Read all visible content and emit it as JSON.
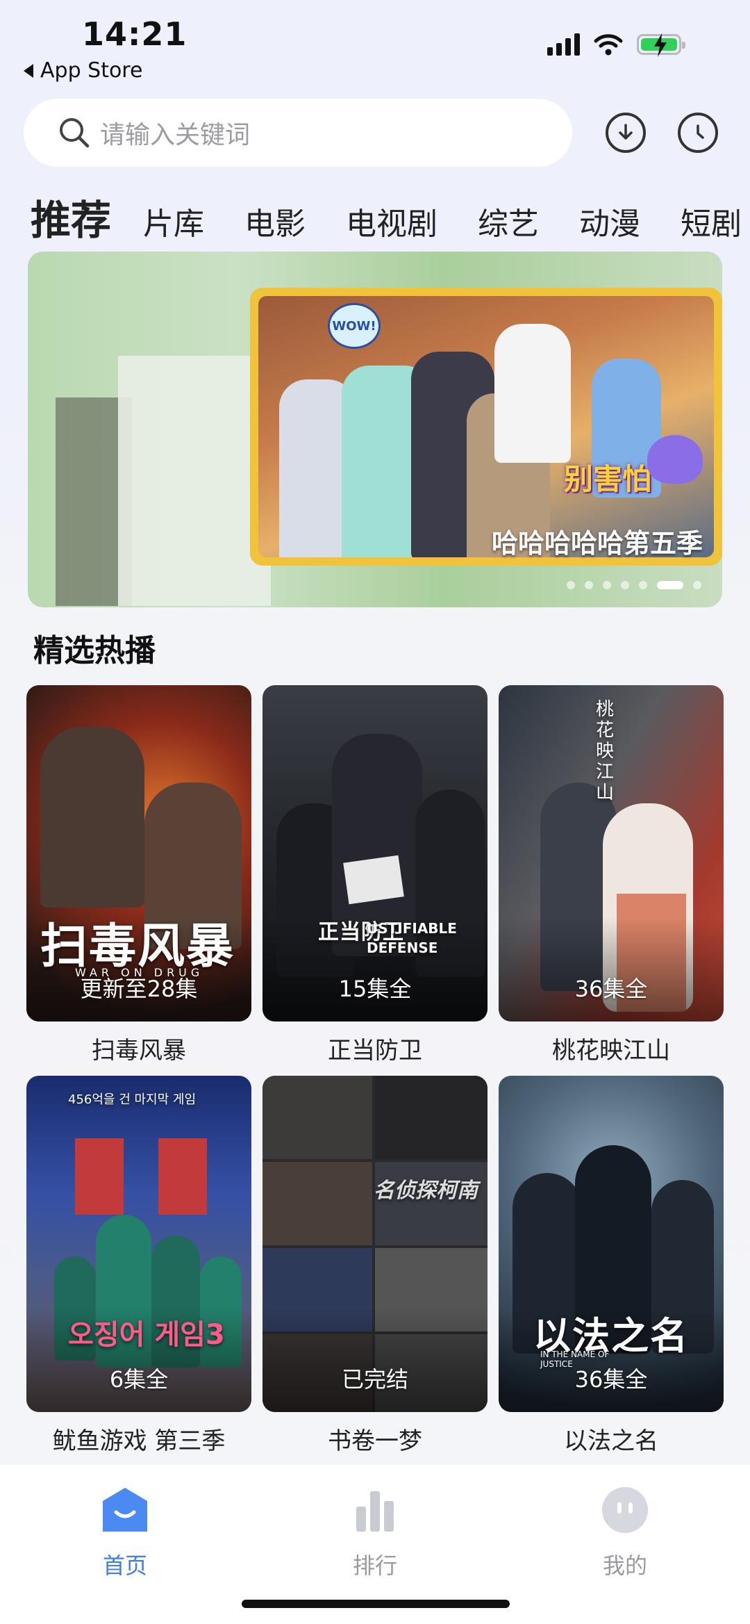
{
  "status_bar": {
    "time": "14:21",
    "back_label": "App Store"
  },
  "search": {
    "placeholder": "请输入关键词"
  },
  "tabs": [
    {
      "label": "推荐",
      "active": true
    },
    {
      "label": "片库"
    },
    {
      "label": "电影"
    },
    {
      "label": "电视剧"
    },
    {
      "label": "综艺"
    },
    {
      "label": "动漫"
    },
    {
      "label": "短剧"
    }
  ],
  "banner": {
    "caption": "哈哈哈哈哈第五季",
    "sticker_text": "别害怕",
    "wow_text": "WOW!",
    "slide_count": 7,
    "active_slide": 6
  },
  "section": {
    "title": "精选热播"
  },
  "cards": [
    {
      "title": "扫毒风暴",
      "badge": "更新至28集",
      "poster_text": "扫毒风暴",
      "poster_sub": "WAR ON DRUG"
    },
    {
      "title": "正当防卫",
      "badge": "15集全",
      "poster_text": "正当防卫",
      "poster_sub": "USTIFIABLE DEFENSE"
    },
    {
      "title": "桃花映江山",
      "badge": "36集全",
      "poster_text": "桃花映江山"
    },
    {
      "title": "鱿鱼游戏 第三季",
      "badge": "6集全",
      "poster_text": "오징어 게임3",
      "poster_top": "456억을 건 마지막 게임"
    },
    {
      "title": "书卷一梦",
      "badge": "已完结",
      "poster_text": "名侦探柯南"
    },
    {
      "title": "以法之名",
      "badge": "36集全",
      "poster_text": "以法之名",
      "poster_sub": "IN THE NAME OF JUSTICE"
    }
  ],
  "bottom_nav": [
    {
      "label": "首页",
      "active": true,
      "color": "#3f7ee8"
    },
    {
      "label": "排行",
      "color": "#9a9aa2"
    },
    {
      "label": "我的",
      "color": "#9a9aa2"
    }
  ]
}
